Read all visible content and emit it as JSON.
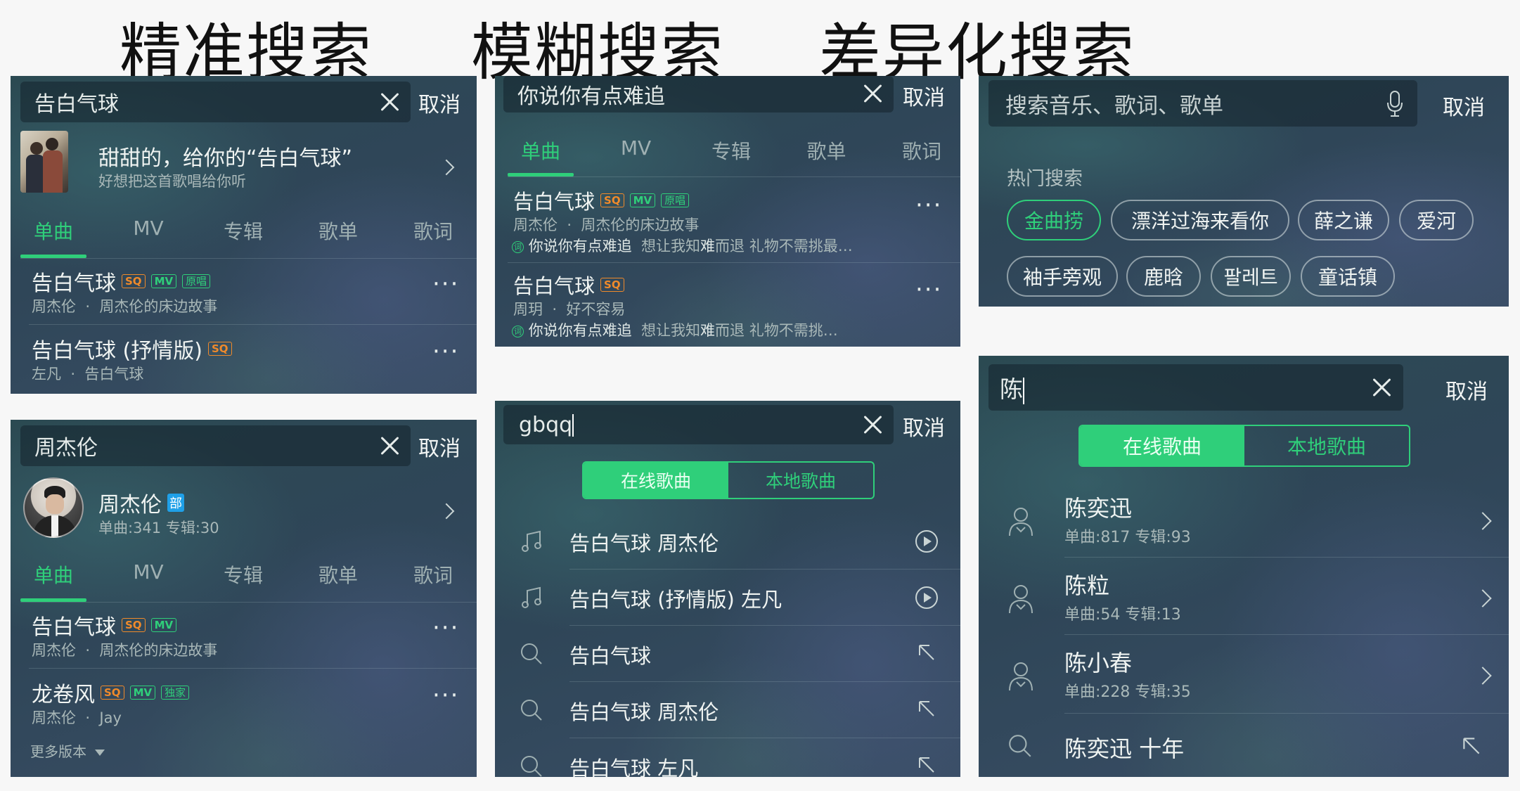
{
  "titles": [
    "精准搜索",
    "模糊搜索",
    "差异化搜索"
  ],
  "common": {
    "cancel": "取消",
    "tabs": [
      "单曲",
      "MV",
      "专辑",
      "歌单",
      "歌词"
    ],
    "badge_sq": "SQ",
    "badge_mv": "MV",
    "badge_original": "原唱",
    "badge_exclusive": "独家",
    "dot": "·"
  },
  "panel1": {
    "query": "告白气球",
    "card_title": "甜甜的，给你的“告白气球”",
    "card_sub": "好想把这首歌唱给你听",
    "songs": [
      {
        "title": "告白气球",
        "artist": "周杰伦",
        "album": "周杰伦的床边故事"
      },
      {
        "title": "告白气球 (抒情版)",
        "artist": "左凡",
        "album": "告白气球"
      }
    ]
  },
  "panel2": {
    "query": "周杰伦",
    "artist_name": "周杰伦",
    "artist_badge": "部",
    "artist_stats": "单曲:341 专辑:30",
    "songs": [
      {
        "title": "告白气球",
        "artist": "周杰伦",
        "album": "周杰伦的床边故事"
      },
      {
        "title": "龙卷风",
        "artist": "周杰伦",
        "album": "Jay"
      }
    ],
    "more_versions": "更多版本"
  },
  "panel3": {
    "query": "你说你有点难追",
    "songs": [
      {
        "title": "告白气球",
        "artist": "周杰伦",
        "album": "周杰伦的床边故事",
        "lyric_icon": "词",
        "lyric_a": "你说你有点难追",
        "lyric_b": "想让我知",
        "lyric_c": "难",
        "lyric_d": "而退  礼物不需挑最…"
      },
      {
        "title": "告白气球",
        "artist": "周玥",
        "album": "好不容易",
        "lyric_icon": "词",
        "lyric_a": "你说你有点难追",
        "lyric_b": "想让我知",
        "lyric_c": "难",
        "lyric_d": "而退  礼物不需挑…"
      }
    ]
  },
  "panel4": {
    "query": "gbqq",
    "seg_online": "在线歌曲",
    "seg_local": "本地歌曲",
    "suggestions": [
      {
        "text": "告白气球 周杰伦",
        "icon": "music-note-icon",
        "action": "play-icon"
      },
      {
        "text": "告白气球 (抒情版) 左凡",
        "icon": "music-note-icon",
        "action": "play-icon"
      },
      {
        "text": "告白气球",
        "icon": "search-icon",
        "action": "fill-arrow-icon"
      },
      {
        "text": "告白气球 周杰伦",
        "icon": "search-icon",
        "action": "fill-arrow-icon"
      },
      {
        "text": "告白气球 左凡",
        "icon": "search-icon",
        "action": "fill-arrow-icon"
      }
    ]
  },
  "panel5": {
    "placeholder": "搜索音乐、歌词、歌单",
    "hot_label": "热门搜索",
    "hot_tags": [
      "金曲捞",
      "漂洋过海来看你",
      "薛之谦",
      "爱河",
      "袖手旁观",
      "鹿晗",
      "팔레트",
      "童话镇"
    ]
  },
  "panel6": {
    "query": "陈",
    "seg_online": "在线歌曲",
    "seg_local": "本地歌曲",
    "artists": [
      {
        "name": "陈奕迅",
        "stats": "单曲:817 专辑:93"
      },
      {
        "name": "陈粒",
        "stats": "单曲:54 专辑:13"
      },
      {
        "name": "陈小春",
        "stats": "单曲:228 专辑:35"
      }
    ],
    "suggestion": "陈奕迅 十年"
  },
  "colors": {
    "accent": "#2fcf7a",
    "sq": "#f08a2a"
  }
}
